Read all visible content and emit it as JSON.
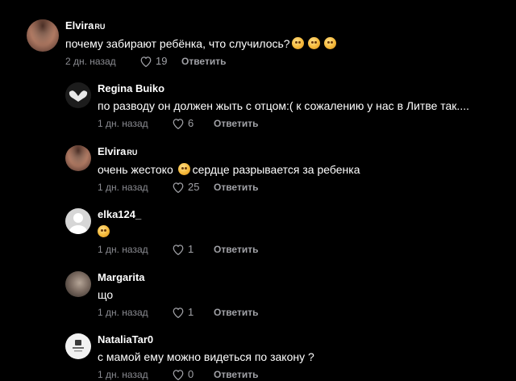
{
  "comments": [
    {
      "username": "Elvira",
      "username_suffix": "RU",
      "text": "почему забирают ребёнка, что случилось?",
      "emoji_count": 3,
      "date": "2 дн. назад",
      "likes": "19",
      "reply_label": "Ответить",
      "avatar_icon": "user-photo-woman",
      "avatar_colors": [
        "#d9a58a",
        "#5a3a30"
      ]
    },
    {
      "username": "Regina Buiko",
      "username_suffix": "",
      "text": "по разводу он должен жыть с отцом:( к сожалению у нас в Литве так....",
      "emoji_count": 0,
      "date": "1 дн. назад",
      "likes": "6",
      "reply_label": "Ответить",
      "avatar_icon": "hands-heart-photo",
      "avatar_colors": [
        "#e8e8e8",
        "#2a2a2a"
      ]
    },
    {
      "username": "Elvira",
      "username_suffix": "RU",
      "text_before": "очень жестоко",
      "text_after": "сердце разрывается за ребенка",
      "emoji_count": 1,
      "date": "1 дн. назад",
      "likes": "25",
      "reply_label": "Ответить",
      "avatar_icon": "user-photo-woman",
      "avatar_colors": [
        "#d9a58a",
        "#5a3a30"
      ]
    },
    {
      "username": "elka124_",
      "username_suffix": "",
      "text": "",
      "emoji_count": 1,
      "date": "1 дн. назад",
      "likes": "1",
      "reply_label": "Ответить",
      "avatar_icon": "default-avatar",
      "avatar_colors": [
        "#d0d0d0",
        "#ffffff"
      ]
    },
    {
      "username": "Margarita",
      "username_suffix": "",
      "text": "що",
      "emoji_count": 0,
      "date": "1 дн. назад",
      "likes": "1",
      "reply_label": "Ответить",
      "avatar_icon": "user-photo",
      "avatar_colors": [
        "#8a7a70",
        "#3a3430"
      ]
    },
    {
      "username": "NataliaTar0",
      "username_suffix": "",
      "text": "с мамой ему можно видеться по закону ?",
      "emoji_count": 0,
      "date": "1 дн. назад",
      "likes": "0",
      "reply_label": "Ответить",
      "avatar_icon": "logo-avatar",
      "avatar_colors": [
        "#f2f2f2",
        "#3a3a3a"
      ]
    }
  ]
}
